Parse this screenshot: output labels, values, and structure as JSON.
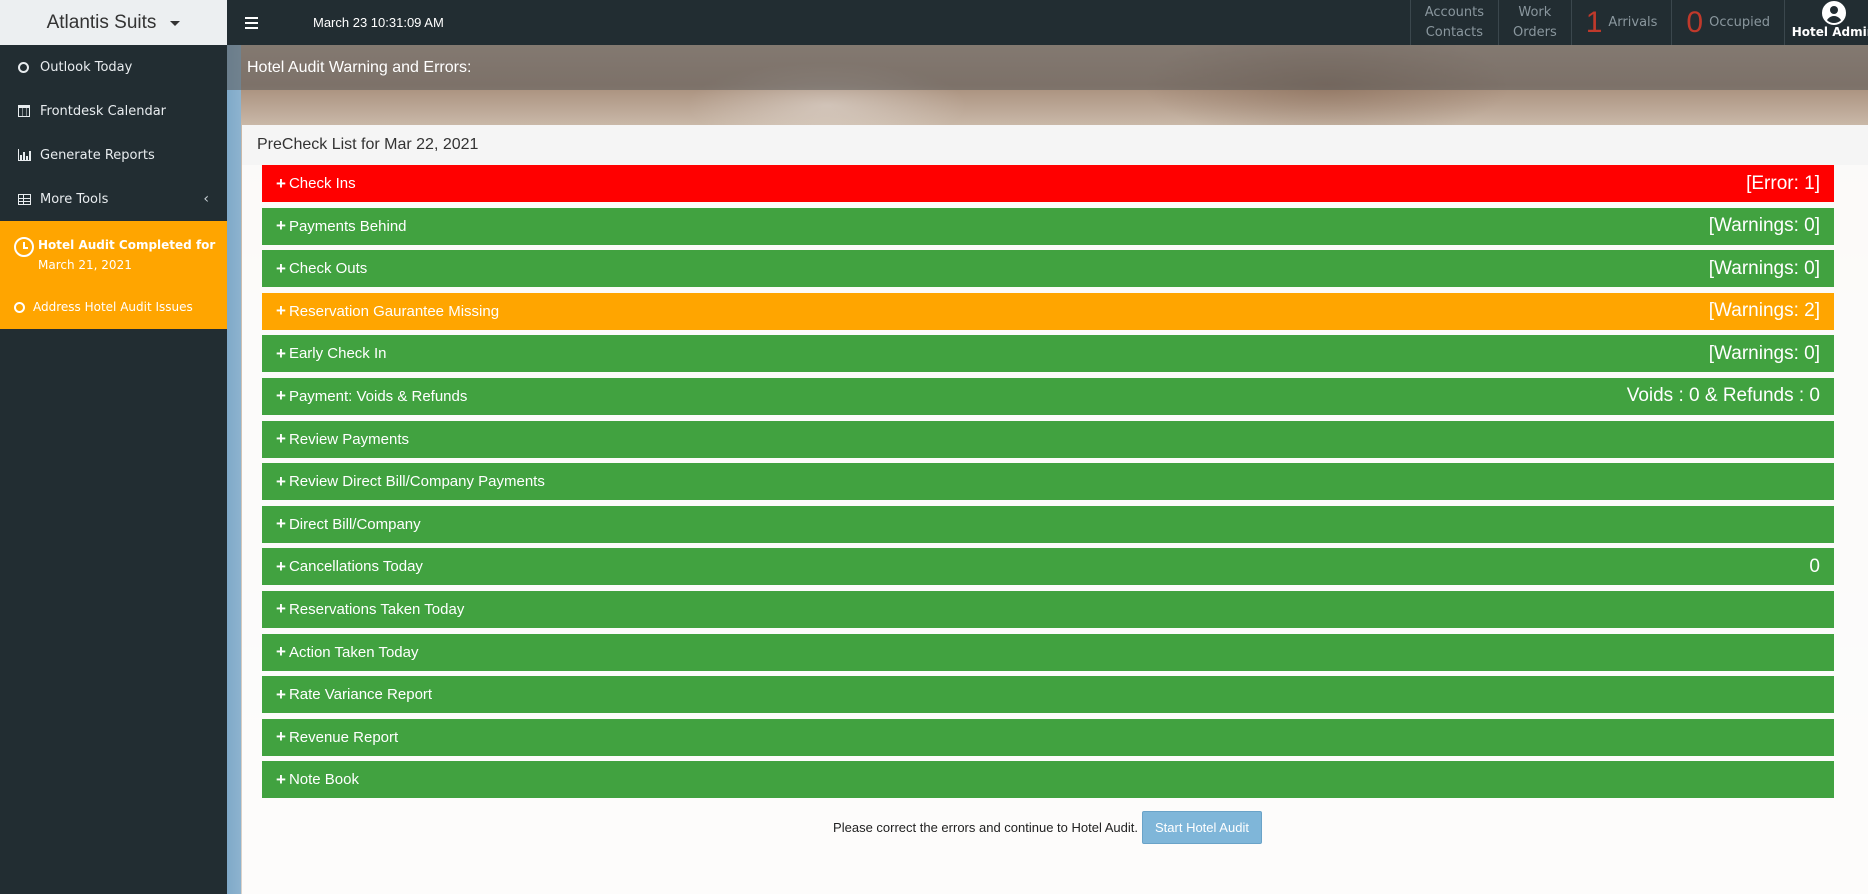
{
  "brand": {
    "title": "Atlantis Suits"
  },
  "sidebar": {
    "items": [
      {
        "label": "Outlook Today",
        "icon": "circle-icon"
      },
      {
        "label": "Frontdesk Calendar",
        "icon": "calendar-icon"
      },
      {
        "label": "Generate Reports",
        "icon": "bar-chart-icon"
      },
      {
        "label": "More Tools",
        "icon": "table-icon"
      }
    ],
    "audit": {
      "title": "Hotel Audit Completed for",
      "date": "March 21, 2021",
      "issue_link": "Address Hotel Audit Issues"
    }
  },
  "topbar": {
    "datetime": "March 23  10:31:09 AM",
    "accounts": "Accounts",
    "contacts": "Contacts",
    "work": "Work",
    "orders": "Orders",
    "arrivals_count": "1",
    "arrivals_label": "Arrivals",
    "occupied_count": "0",
    "occupied_label": "Occupied",
    "user": "Hotel Admin"
  },
  "main": {
    "header": "Hotel Audit Warning and Errors:",
    "panel_title": "PreCheck List for Mar 22, 2021",
    "rows": [
      {
        "label": " Check Ins",
        "status": "[Error: 1]",
        "color": "#ff0000"
      },
      {
        "label": " Payments Behind",
        "status": "[Warnings: 0]",
        "color": "#41a240"
      },
      {
        "label": " Check Outs",
        "status": "[Warnings: 0]",
        "color": "#41a240"
      },
      {
        "label": " Reservation Gaurantee Missing",
        "status": "[Warnings: 2]",
        "color": "#ffa500"
      },
      {
        "label": " Early Check In",
        "status": "[Warnings: 0]",
        "color": "#41a240"
      },
      {
        "label": "Payment: Voids & Refunds",
        "status": "Voids : 0 & Refunds : 0",
        "color": "#41a240"
      },
      {
        "label": " Review Payments",
        "status": "",
        "color": "#41a240"
      },
      {
        "label": " Review Direct Bill/Company Payments",
        "status": "",
        "color": "#41a240"
      },
      {
        "label": " Direct Bill/Company",
        "status": "",
        "color": "#41a240"
      },
      {
        "label": " Cancellations Today",
        "status": "0",
        "color": "#41a240"
      },
      {
        "label": " Reservations Taken Today",
        "status": "",
        "color": "#41a240"
      },
      {
        "label": " Action Taken Today",
        "status": "",
        "color": "#41a240"
      },
      {
        "label": " Rate Variance Report",
        "status": "",
        "color": "#41a240"
      },
      {
        "label": " Revenue Report",
        "status": "",
        "color": "#41a240"
      },
      {
        "label": " Note Book",
        "status": "",
        "color": "#41a240"
      }
    ],
    "footer_text": "Please correct the errors and continue to Hotel Audit.",
    "start_button": "Start Hotel Audit"
  }
}
